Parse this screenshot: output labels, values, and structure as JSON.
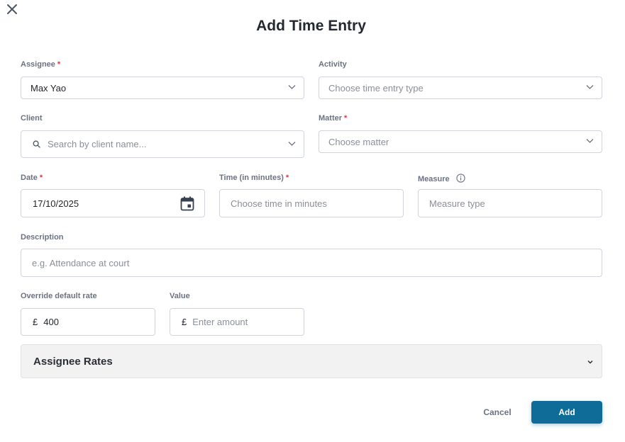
{
  "dialog": {
    "title": "Add Time Entry"
  },
  "assignee": {
    "label": "Assignee",
    "value": "Max Yao"
  },
  "activity": {
    "label": "Activity",
    "placeholder": "Choose time entry type"
  },
  "client": {
    "label": "Client",
    "placeholder": "Search by client name..."
  },
  "matter": {
    "label": "Matter",
    "placeholder": "Choose matter"
  },
  "date": {
    "label": "Date",
    "value": "17/10/2025"
  },
  "time": {
    "label": "Time (in minutes)",
    "placeholder": "Choose time in minutes"
  },
  "measure": {
    "label": "Measure",
    "placeholder": "Measure type"
  },
  "description": {
    "label": "Description",
    "placeholder": "e.g. Attendance at court"
  },
  "rate": {
    "label": "Override default rate",
    "currency": "£",
    "value": "400"
  },
  "amount": {
    "label": "Value",
    "currency": "£",
    "placeholder": "Enter amount"
  },
  "rates_section": {
    "title": "Assignee Rates"
  },
  "actions": {
    "cancel": "Cancel",
    "add": "Add"
  },
  "required_marker": "*",
  "colors": {
    "primary": "#0f6c98",
    "required": "#dc3545",
    "border": "#d1d5db",
    "panel": "#f2f2f3"
  },
  "icons": [
    "close-icon",
    "chevron-down-icon",
    "search-icon",
    "calendar-icon",
    "info-icon"
  ]
}
